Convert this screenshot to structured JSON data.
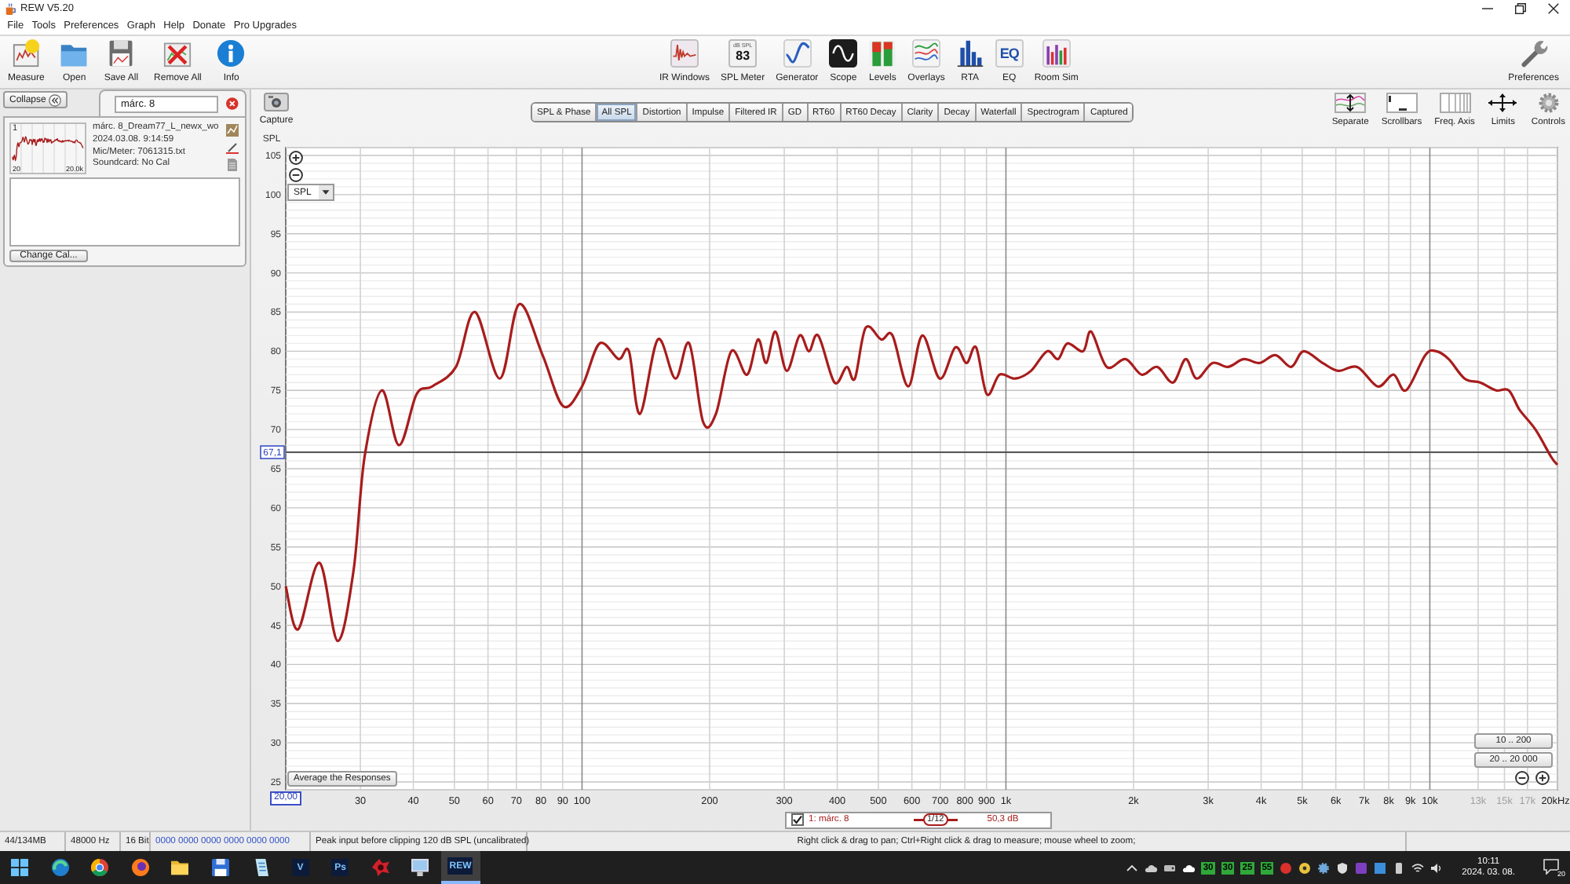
{
  "window": {
    "title": "REW V5.20"
  },
  "menu": [
    "File",
    "Tools",
    "Preferences",
    "Graph",
    "Help",
    "Donate",
    "Pro Upgrades"
  ],
  "toolbar": {
    "left": [
      {
        "kind": "measure",
        "label": "Measure"
      },
      {
        "kind": "open",
        "label": "Open"
      },
      {
        "kind": "save",
        "label": "Save All"
      },
      {
        "kind": "remove",
        "label": "Remove All"
      },
      {
        "kind": "info",
        "label": "Info"
      }
    ],
    "center": [
      {
        "kind": "ir",
        "label": "IR Windows"
      },
      {
        "kind": "meter",
        "label": "SPL Meter",
        "unit": "dB SPL",
        "reading": "83"
      },
      {
        "kind": "generator",
        "label": "Generator"
      },
      {
        "kind": "scope",
        "label": "Scope"
      },
      {
        "kind": "levels",
        "label": "Levels"
      },
      {
        "kind": "overlays",
        "label": "Overlays"
      },
      {
        "kind": "rta",
        "label": "RTA"
      },
      {
        "kind": "eq",
        "label": "EQ",
        "icon_text": "EQ"
      },
      {
        "kind": "roomsim",
        "label": "Room Sim"
      }
    ],
    "right": [
      {
        "kind": "preferences",
        "label": "Preferences"
      }
    ]
  },
  "sidebar": {
    "collapse": "Collapse",
    "search": {
      "value": "márc. 8"
    },
    "measurement": {
      "index": "1",
      "axis_start": "20",
      "axis_end": "20.0k",
      "name": "márc. 8_Dream77_L_newx_wo",
      "date": "2024.03.08. 9:14:59",
      "mic": "Mic/Meter: 7061315.txt",
      "soundcard": "Soundcard: No Cal"
    },
    "change_cal": "Change Cal..."
  },
  "graph": {
    "capture": "Capture",
    "tabs": [
      {
        "label": "SPL & Phase",
        "selected": false
      },
      {
        "label": "All SPL",
        "selected": true
      },
      {
        "label": "Distortion",
        "selected": false
      },
      {
        "label": "Impulse",
        "selected": false
      },
      {
        "label": "Filtered IR",
        "selected": false
      },
      {
        "label": "GD",
        "selected": false
      },
      {
        "label": "RT60",
        "selected": false
      },
      {
        "label": "RT60 Decay",
        "selected": false
      },
      {
        "label": "Clarity",
        "selected": false
      },
      {
        "label": "Decay",
        "selected": false
      },
      {
        "label": "Waterfall",
        "selected": false
      },
      {
        "label": "Spectrogram",
        "selected": false
      },
      {
        "label": "Captured",
        "selected": false
      }
    ],
    "tools": [
      {
        "kind": "separate",
        "label": "Separate"
      },
      {
        "kind": "scrollbars",
        "label": "Scrollbars"
      },
      {
        "kind": "freqaxis",
        "label": "Freq. Axis"
      },
      {
        "kind": "limits",
        "label": "Limits"
      },
      {
        "kind": "controls",
        "label": "Controls"
      }
    ],
    "y_select": "SPL",
    "average_button": "Average the Responses",
    "range_buttons": [
      "10 .. 200",
      "20 .. 20 000"
    ],
    "x_start": "20,00",
    "chart_data": {
      "type": "line",
      "log": "x",
      "grid": true,
      "xlabel": "Hz",
      "ylabel": "SPL",
      "x": [
        20,
        21.4,
        24,
        26.5,
        28.9,
        30.7,
        33.7,
        37,
        40.7,
        44.3,
        50.4,
        55.9,
        64,
        71,
        80.7,
        90.2,
        100,
        110,
        122,
        129,
        137,
        151,
        166,
        179,
        193,
        207,
        225,
        245,
        260,
        272,
        286,
        304,
        326,
        343,
        361,
        394,
        421,
        440,
        467,
        508,
        540,
        588,
        635,
        698,
        760,
        807,
        850,
        902,
        966,
        1052,
        1146,
        1250,
        1327,
        1397,
        1521,
        1589,
        1730,
        1915,
        2090,
        2275,
        2478,
        2654,
        2818,
        3069,
        3343,
        3640,
        3964,
        4324,
        4710,
        5036,
        5585,
        6082,
        6745,
        7535,
        8208,
        8790,
        9750,
        10350,
        11080,
        12080,
        13150,
        14330,
        15350,
        16290,
        17750,
        19330,
        20000
      ],
      "series": [
        {
          "name": "1: márc. 8",
          "color": "#a81c1c",
          "values": [
            50,
            44.5,
            53,
            43,
            52,
            66.5,
            75,
            68,
            74.5,
            75.5,
            78,
            85,
            76.5,
            86,
            79.5,
            73,
            75.5,
            81,
            79,
            80,
            72,
            81.5,
            76.5,
            81,
            71,
            72,
            80,
            77,
            81.5,
            78.5,
            82.5,
            77.5,
            82,
            80,
            82,
            76,
            78,
            76.5,
            83,
            81.5,
            82,
            75.5,
            82,
            76.5,
            80.5,
            78.5,
            80.5,
            74.5,
            77,
            76.5,
            77.5,
            80,
            79,
            81,
            80,
            82.5,
            78,
            79,
            77,
            78,
            76,
            79,
            76.5,
            78.5,
            78,
            79,
            78.5,
            79.5,
            78,
            80,
            78.5,
            77.5,
            78,
            75.5,
            77,
            75,
            79.5,
            80,
            79,
            76.5,
            76,
            75,
            75,
            72.5,
            70,
            66.5,
            65.5
          ]
        }
      ],
      "xlim": [
        20,
        20000
      ],
      "ylim": [
        24,
        106
      ],
      "xticks": [
        {
          "value": 30,
          "label": "30"
        },
        {
          "value": 40,
          "label": "40"
        },
        {
          "value": 50,
          "label": "50"
        },
        {
          "value": 60,
          "label": "60"
        },
        {
          "value": 70,
          "label": "70"
        },
        {
          "value": 80,
          "label": "80"
        },
        {
          "value": 90,
          "label": "90"
        },
        {
          "value": 100,
          "label": "100"
        },
        {
          "value": 200,
          "label": "200"
        },
        {
          "value": 300,
          "label": "300"
        },
        {
          "value": 400,
          "label": "400"
        },
        {
          "value": 500,
          "label": "500"
        },
        {
          "value": 600,
          "label": "600"
        },
        {
          "value": 700,
          "label": "700"
        },
        {
          "value": 800,
          "label": "800"
        },
        {
          "value": 900,
          "label": "900"
        },
        {
          "value": 1000,
          "label": "1k"
        },
        {
          "value": 2000,
          "label": "2k"
        },
        {
          "value": 3000,
          "label": "3k"
        },
        {
          "value": 4000,
          "label": "4k"
        },
        {
          "value": 5000,
          "label": "5k"
        },
        {
          "value": 6000,
          "label": "6k"
        },
        {
          "value": 7000,
          "label": "7k"
        },
        {
          "value": 8000,
          "label": "8k"
        },
        {
          "value": 9000,
          "label": "9k"
        },
        {
          "value": 10000,
          "label": "10k"
        },
        {
          "value": 13000,
          "label": "13k"
        },
        {
          "value": 15000,
          "label": "15k"
        },
        {
          "value": 17000,
          "label": "17k"
        },
        {
          "value": 20000,
          "label": "20k"
        }
      ],
      "yticks": [
        25,
        30,
        35,
        40,
        45,
        50,
        55,
        60,
        65,
        70,
        75,
        80,
        85,
        90,
        95,
        100,
        105
      ],
      "ref_lines": [
        {
          "axis": "y",
          "value": 67.1,
          "label": "67,1"
        }
      ]
    }
  },
  "legend": {
    "checked": true,
    "smoothing": "1/12",
    "value": "50,3 dB"
  },
  "status_bar": [
    "44/134MB",
    "48000 Hz",
    "16 Bit",
    "0000 0000  0000 0000  0000 0000",
    "Peak input before clipping 120 dB SPL (uncalibrated)",
    "Right click & drag to pan; Ctrl+Right click & drag to measure; mouse wheel to zoom;"
  ],
  "taskbar": {
    "apps": [
      {
        "kind": "start",
        "selected": false
      },
      {
        "kind": "swirl",
        "selected": false
      },
      {
        "kind": "ring",
        "selected": false
      },
      {
        "kind": "disc",
        "selected": false
      },
      {
        "kind": "folder",
        "selected": false
      },
      {
        "kind": "floppy",
        "selected": false
      },
      {
        "kind": "document",
        "selected": false
      },
      {
        "kind": "letter",
        "text": "V",
        "selected": false
      },
      {
        "kind": "letter",
        "text": "Ps",
        "selected": false
      },
      {
        "kind": "splash",
        "selected": false
      },
      {
        "kind": "monitor",
        "selected": false
      },
      {
        "kind": "letter",
        "text": "REW",
        "selected": true
      }
    ],
    "tray_counters": [
      "30",
      "30",
      "25",
      "55"
    ],
    "time": "10:11",
    "date": "2024. 03. 08.",
    "notifications": "20"
  }
}
